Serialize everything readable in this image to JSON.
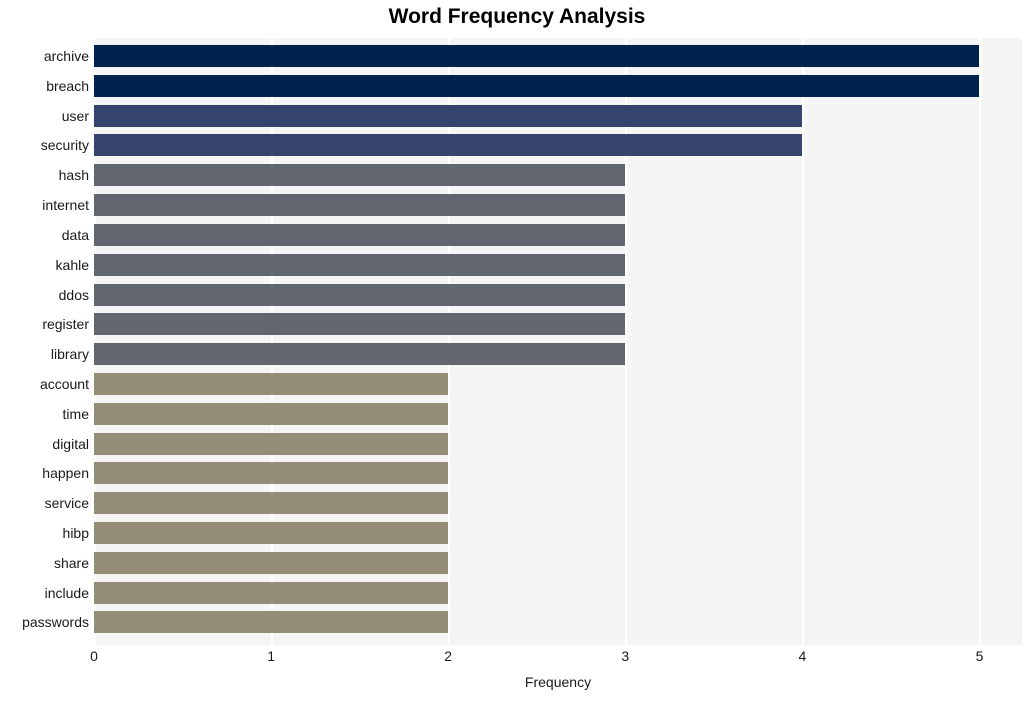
{
  "chart_data": {
    "type": "bar",
    "orientation": "horizontal",
    "title": "Word Frequency Analysis",
    "xlabel": "Frequency",
    "ylabel": "",
    "xlim": [
      0,
      5.24
    ],
    "xticks": [
      "0",
      "1",
      "2",
      "3",
      "4",
      "5"
    ],
    "xtick_values": [
      0,
      1,
      2,
      3,
      4,
      5
    ],
    "grid": "vertical-white",
    "legend": "none",
    "categories": [
      "archive",
      "breach",
      "user",
      "security",
      "hash",
      "internet",
      "data",
      "kahle",
      "ddos",
      "register",
      "library",
      "account",
      "time",
      "digital",
      "happen",
      "service",
      "hibp",
      "share",
      "include",
      "passwords"
    ],
    "values": [
      5,
      5,
      4,
      4,
      3,
      3,
      3,
      3,
      3,
      3,
      3,
      2,
      2,
      2,
      2,
      2,
      2,
      2,
      2,
      2
    ],
    "bar_colors": [
      "#00224e",
      "#00224e",
      "#36436c",
      "#36436c",
      "#62666e",
      "#62666e",
      "#62666e",
      "#62666e",
      "#62666e",
      "#62666e",
      "#62666e",
      "#938c76",
      "#938c76",
      "#938c76",
      "#938c76",
      "#938c76",
      "#938c76",
      "#938c76",
      "#938c76",
      "#938c76"
    ]
  },
  "style": {
    "plot_background": "#f5f5f6",
    "figure_background": "#ffffff",
    "gridline_color": "#ffffff",
    "text_color": "#1a1a1a",
    "title_color": "#000000"
  }
}
